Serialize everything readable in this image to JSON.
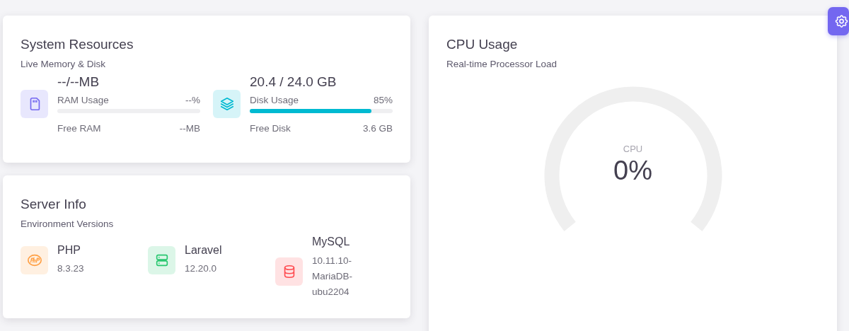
{
  "system_resources": {
    "title": "System Resources",
    "subtitle": "Live Memory & Disk",
    "items": [
      {
        "kind": "memory",
        "color": "#7367f0",
        "total": "--/--MB",
        "usage_label": "RAM Usage",
        "percent": "--%",
        "level": 0,
        "free_label": "Free RAM",
        "free_value": "--MB"
      },
      {
        "kind": "disk",
        "color": "#00bad1",
        "total": "20.4 / 24.0 GB",
        "usage_label": "Disk Usage",
        "percent": "85%",
        "level": 0.85,
        "free_label": "Free Disk",
        "free_value": "3.6 GB"
      }
    ]
  },
  "server_info": {
    "title": "Server Info",
    "subtitle": "Environment Versions",
    "items": [
      {
        "kind": "php",
        "color": "#ff9f43",
        "name": "PHP",
        "version": "8.3.23"
      },
      {
        "kind": "server",
        "color": "#28c76f",
        "name": "Laravel",
        "version": "12.20.0"
      },
      {
        "kind": "database",
        "color": "#ff4c51",
        "name": "MySQL",
        "version": "10.11.10-MariaDB-ubu2204"
      }
    ]
  },
  "cpu_usage": {
    "title": "CPU Usage",
    "subtitle": "Real-time Processor Load",
    "gauge_label": "CPU",
    "gauge_value": "0%"
  }
}
